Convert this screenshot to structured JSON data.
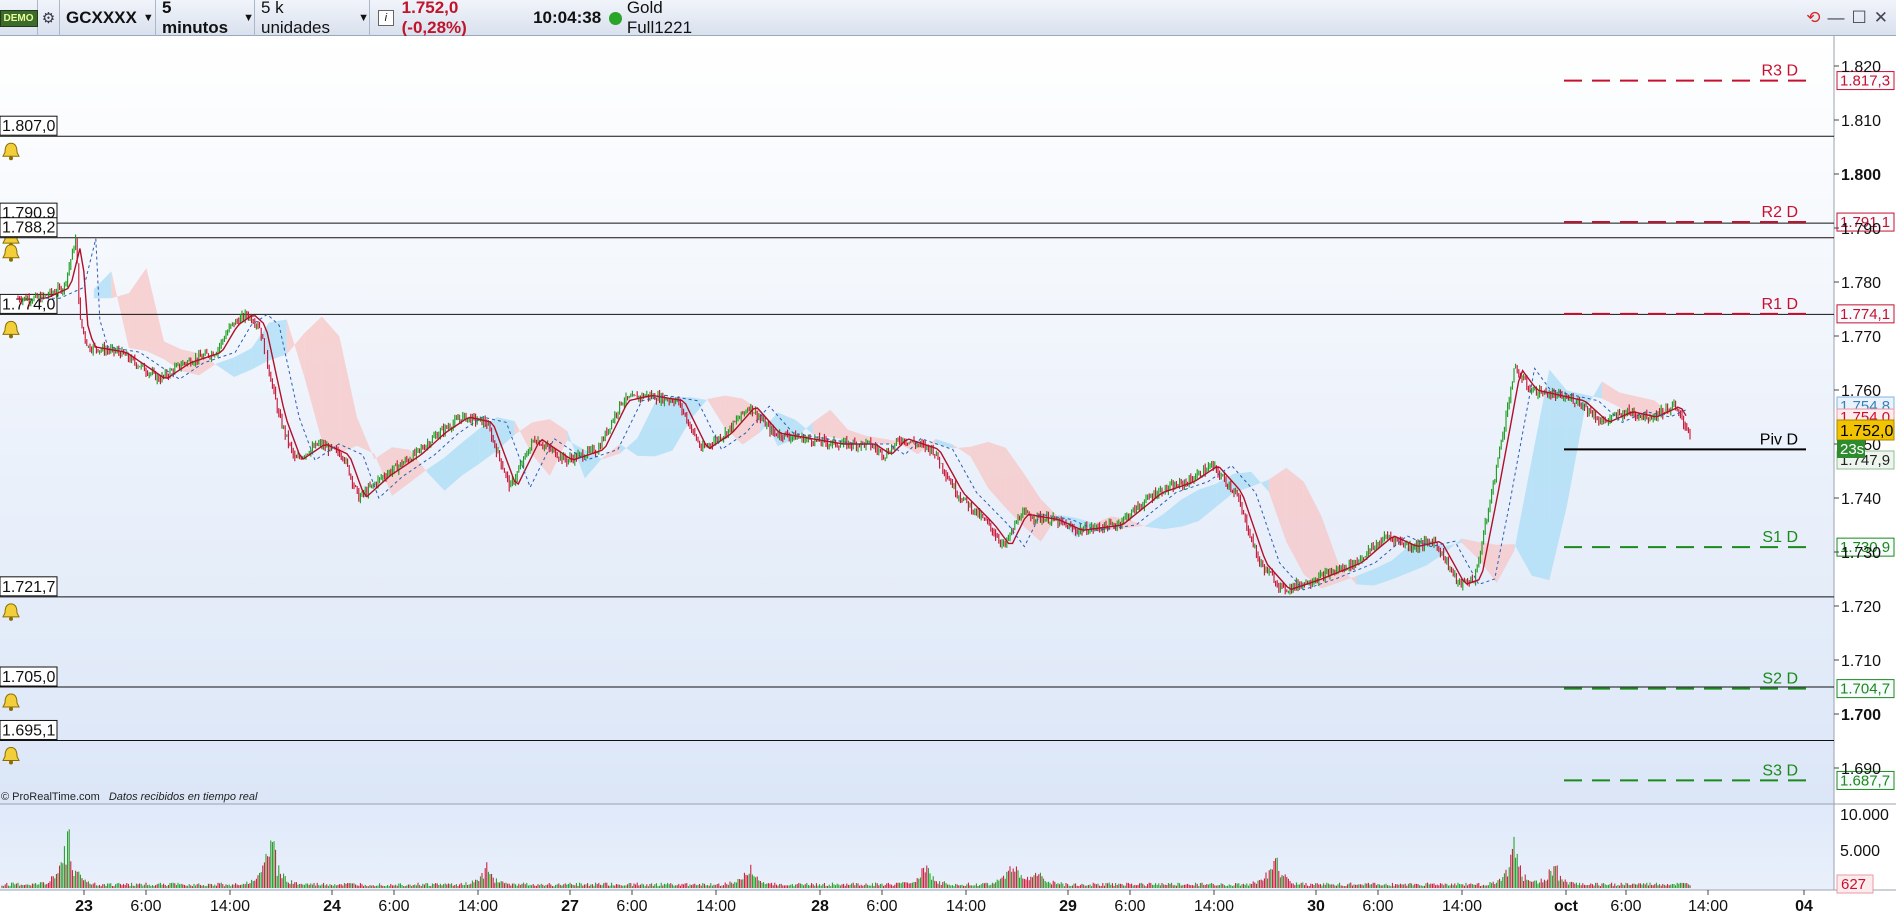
{
  "toolbar": {
    "demo_badge": "DEMO",
    "symbol": "GCXXXX",
    "timeframe": "5 minutos",
    "units": "5 k unidades",
    "price_change": "1.752,0 (-0,28%)",
    "time": "10:04:38",
    "instrument": "Gold Full1221"
  },
  "footer": {
    "copyright": "© ProRealTime.com",
    "realtime_note": "Datos recibidos en tiempo real"
  },
  "price_axis": {
    "labels": [
      "1.820",
      "1.810",
      "1.800",
      "1.790",
      "1.780",
      "1.770",
      "1.760",
      "1.750",
      "1.740",
      "1.730",
      "1.720",
      "1.710",
      "1.700",
      "1.690"
    ],
    "bold_labels": [
      "1.800",
      "1.700"
    ],
    "last_price_tag": "1.752,0",
    "countdown_tag": "23s",
    "tag_1754_8": "1.754,8",
    "tag_1754_0": "1.754,0",
    "tag_1747_9": "1.747,9"
  },
  "pivots": [
    {
      "name": "R3 D",
      "value": 1817.3,
      "tag": "1.817,3",
      "color": "#c8102e"
    },
    {
      "name": "R2 D",
      "value": 1791.1,
      "tag": "1.791,1",
      "color": "#c8102e"
    },
    {
      "name": "R1 D",
      "value": 1774.1,
      "tag": "1.774,1",
      "color": "#c8102e"
    },
    {
      "name": "Piv D",
      "value": 1749.0,
      "tag": "",
      "color": "#000000"
    },
    {
      "name": "S1 D",
      "value": 1730.9,
      "tag": "1.730,9",
      "color": "#1a8a1a"
    },
    {
      "name": "S2 D",
      "value": 1704.7,
      "tag": "1.704,7",
      "color": "#1a8a1a"
    },
    {
      "name": "S3 D",
      "value": 1687.7,
      "tag": "1.687,7",
      "color": "#1a8a1a"
    }
  ],
  "alert_lines": [
    {
      "label": "1.807,0",
      "value": 1807.0
    },
    {
      "label": "1.790,9",
      "value": 1790.9
    },
    {
      "label": "1.788,2",
      "value": 1788.2
    },
    {
      "label": "1.774,0",
      "value": 1774.0
    },
    {
      "label": "1.721,7",
      "value": 1721.7
    },
    {
      "label": "1.705,0",
      "value": 1705.0
    },
    {
      "label": "1.695,1",
      "value": 1695.1
    }
  ],
  "volume_axis": {
    "labels": [
      "10.000",
      "5.000"
    ],
    "last_volume_tag": "627"
  },
  "time_axis": {
    "labels": [
      "23",
      "6:00",
      "14:00",
      "24",
      "6:00",
      "14:00",
      "27",
      "6:00",
      "14:00",
      "28",
      "6:00",
      "14:00",
      "29",
      "6:00",
      "14:00",
      "30",
      "6:00",
      "14:00",
      "oct",
      "6:00",
      "14:00",
      "04"
    ],
    "bold_labels": [
      "23",
      "24",
      "27",
      "28",
      "29",
      "30",
      "oct",
      "04"
    ]
  },
  "chart_data": {
    "type": "candlestick",
    "y_axis_range": [
      1686,
      1825
    ],
    "volume_axis_range": [
      0,
      12000
    ],
    "price_path": [
      {
        "t": 0,
        "p": 1777
      },
      {
        "t": 0.3,
        "p": 1779
      },
      {
        "t": 0.45,
        "p": 1788
      },
      {
        "t": 0.5,
        "p": 1773
      },
      {
        "t": 0.6,
        "p": 1768
      },
      {
        "t": 1,
        "p": 1767
      },
      {
        "t": 1.3,
        "p": 1764
      },
      {
        "t": 1.5,
        "p": 1762
      },
      {
        "t": 1.8,
        "p": 1765
      },
      {
        "t": 2.2,
        "p": 1767
      },
      {
        "t": 2.4,
        "p": 1772
      },
      {
        "t": 2.6,
        "p": 1774
      },
      {
        "t": 2.75,
        "p": 1772
      },
      {
        "t": 3,
        "p": 1755
      },
      {
        "t": 3.2,
        "p": 1747
      },
      {
        "t": 3.5,
        "p": 1750
      },
      {
        "t": 3.8,
        "p": 1748
      },
      {
        "t": 4,
        "p": 1740
      },
      {
        "t": 4.3,
        "p": 1744
      },
      {
        "t": 4.7,
        "p": 1748
      },
      {
        "t": 5,
        "p": 1752
      },
      {
        "t": 5.3,
        "p": 1755
      },
      {
        "t": 5.6,
        "p": 1754
      },
      {
        "t": 5.9,
        "p": 1742
      },
      {
        "t": 6.2,
        "p": 1751
      },
      {
        "t": 6.6,
        "p": 1747
      },
      {
        "t": 7,
        "p": 1749
      },
      {
        "t": 7.3,
        "p": 1758
      },
      {
        "t": 7.6,
        "p": 1759
      },
      {
        "t": 8,
        "p": 1758
      },
      {
        "t": 8.3,
        "p": 1749
      },
      {
        "t": 8.6,
        "p": 1752
      },
      {
        "t": 8.9,
        "p": 1757
      },
      {
        "t": 9.2,
        "p": 1752
      },
      {
        "t": 9.6,
        "p": 1751
      },
      {
        "t": 10,
        "p": 1750
      },
      {
        "t": 10.4,
        "p": 1750
      },
      {
        "t": 10.6,
        "p": 1748
      },
      {
        "t": 10.8,
        "p": 1751
      },
      {
        "t": 11.2,
        "p": 1749
      },
      {
        "t": 11.5,
        "p": 1741
      },
      {
        "t": 11.7,
        "p": 1738
      },
      {
        "t": 11.9,
        "p": 1735
      },
      {
        "t": 12.1,
        "p": 1731
      },
      {
        "t": 12.3,
        "p": 1737
      },
      {
        "t": 12.7,
        "p": 1736
      },
      {
        "t": 13,
        "p": 1734
      },
      {
        "t": 13.5,
        "p": 1735
      },
      {
        "t": 14,
        "p": 1741
      },
      {
        "t": 14.4,
        "p": 1743
      },
      {
        "t": 14.7,
        "p": 1746
      },
      {
        "t": 15,
        "p": 1741
      },
      {
        "t": 15.3,
        "p": 1728
      },
      {
        "t": 15.6,
        "p": 1723
      },
      {
        "t": 16,
        "p": 1725
      },
      {
        "t": 16.5,
        "p": 1728
      },
      {
        "t": 16.9,
        "p": 1733
      },
      {
        "t": 17.2,
        "p": 1731
      },
      {
        "t": 17.5,
        "p": 1732
      },
      {
        "t": 17.8,
        "p": 1724
      },
      {
        "t": 18,
        "p": 1725
      },
      {
        "t": 18.2,
        "p": 1740
      },
      {
        "t": 18.5,
        "p": 1764
      },
      {
        "t": 18.7,
        "p": 1760
      },
      {
        "t": 19,
        "p": 1759
      },
      {
        "t": 19.3,
        "p": 1758
      },
      {
        "t": 19.6,
        "p": 1754
      },
      {
        "t": 19.9,
        "p": 1756
      },
      {
        "t": 20.2,
        "p": 1755
      },
      {
        "t": 20.5,
        "p": 1757
      },
      {
        "t": 20.7,
        "p": 1752
      }
    ],
    "volume_spikes": [
      {
        "t": 0.35,
        "v": 10500
      },
      {
        "t": 2.9,
        "v": 10500
      },
      {
        "t": 5.6,
        "v": 3600
      },
      {
        "t": 8.9,
        "v": 4200
      },
      {
        "t": 11.1,
        "v": 4000
      },
      {
        "t": 12.2,
        "v": 5200
      },
      {
        "t": 12.5,
        "v": 3400
      },
      {
        "t": 15.5,
        "v": 6500
      },
      {
        "t": 18.5,
        "v": 7500
      },
      {
        "t": 19,
        "v": 4200
      }
    ]
  },
  "colors": {
    "bull": "#1a9a1a",
    "bear": "#c8102e",
    "cloud_bull": "#a9dcf5",
    "cloud_bear": "#f7c6c6",
    "last_price_bg": "#f2c300",
    "countdown_bg": "#2e8b2e"
  }
}
